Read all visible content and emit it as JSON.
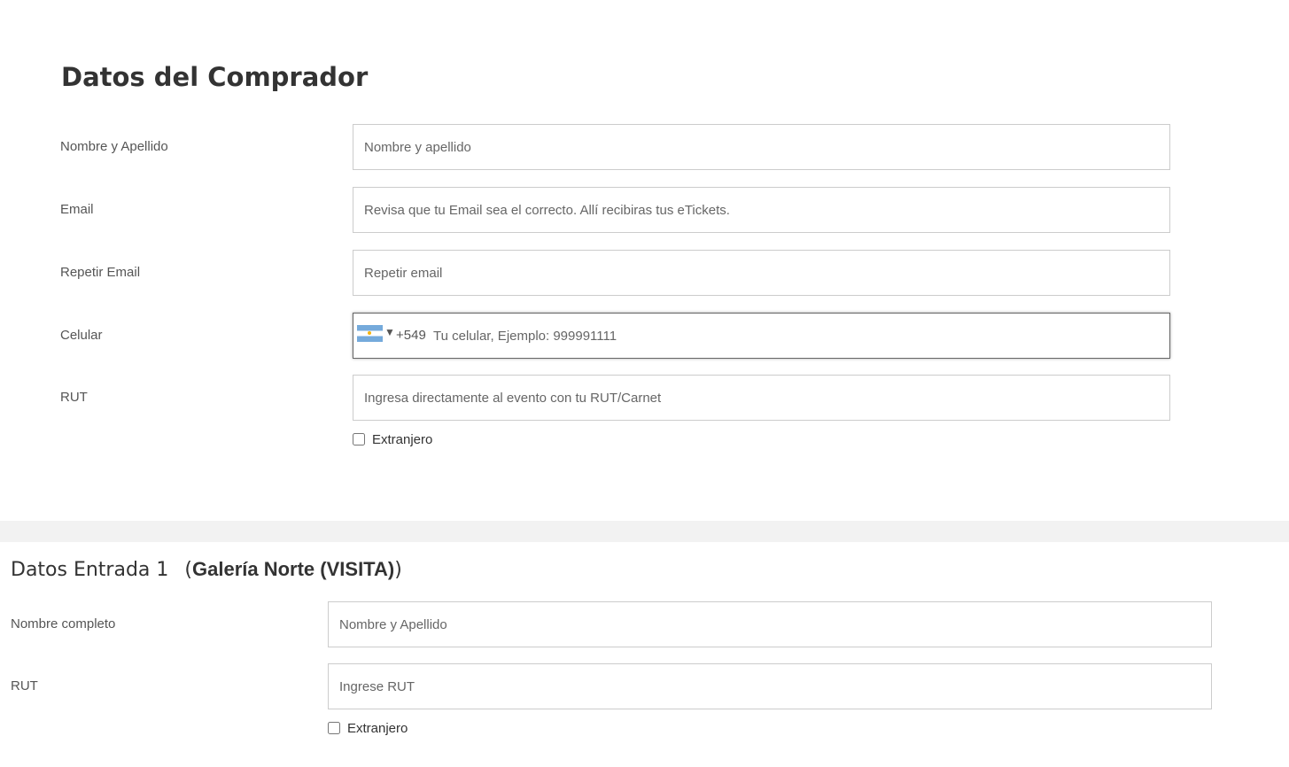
{
  "buyer": {
    "title": "Datos del Comprador",
    "fields": {
      "name": {
        "label": "Nombre y Apellido",
        "placeholder": "Nombre y apellido",
        "value": ""
      },
      "email": {
        "label": "Email",
        "placeholder": "Revisa que tu Email sea el correcto. Allí recibiras tus eTickets.",
        "value": ""
      },
      "email_repeat": {
        "label": "Repetir Email",
        "placeholder": "Repetir email",
        "value": ""
      },
      "phone": {
        "label": "Celular",
        "country_flag": "argentina-flag-icon",
        "caret": "▼",
        "dial_code": "+549",
        "placeholder": "Tu celular, Ejemplo: 999991111",
        "value": ""
      },
      "rut": {
        "label": "RUT",
        "placeholder": "Ingresa directamente al evento con tu RUT/Carnet",
        "value": ""
      }
    },
    "foreigner": {
      "label": "Extranjero",
      "checked": false
    }
  },
  "ticket": {
    "title": "Datos Entrada 1",
    "paren_open": "(",
    "type": "Galería Norte (VISITA)",
    "paren_close": ")",
    "fields": {
      "full_name": {
        "label": "Nombre completo",
        "placeholder": "Nombre y Apellido",
        "value": ""
      },
      "rut": {
        "label": "RUT",
        "placeholder": "Ingrese RUT",
        "value": ""
      }
    },
    "foreigner": {
      "label": "Extranjero",
      "checked": false
    }
  },
  "colors": {
    "background": "#ffffff",
    "divider": "#f2f2f2",
    "border": "#cccccc",
    "text": "#555555",
    "heading": "#333333",
    "flag_blue": "#75aadb"
  }
}
